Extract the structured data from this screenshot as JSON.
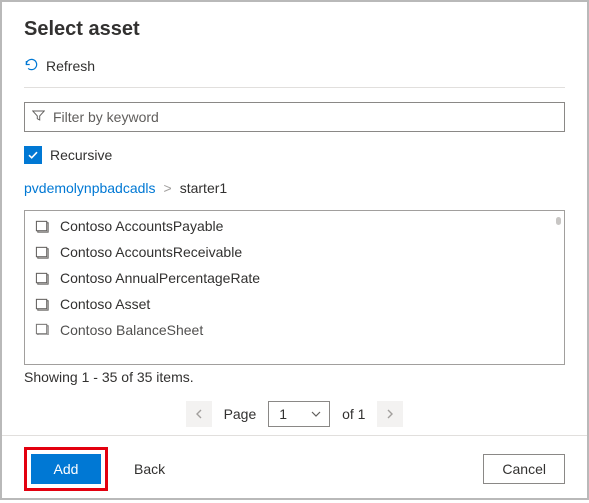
{
  "dialog": {
    "title": "Select asset"
  },
  "toolbar": {
    "refresh_label": "Refresh"
  },
  "filter": {
    "placeholder": "Filter by keyword",
    "value": ""
  },
  "recursive": {
    "label": "Recursive",
    "checked": true
  },
  "breadcrumb": {
    "root": "pvdemolynpbadcadls",
    "sep": ">",
    "current": "starter1"
  },
  "assets": [
    "Contoso AccountsPayable",
    "Contoso AccountsReceivable",
    "Contoso AnnualPercentageRate",
    "Contoso Asset",
    "Contoso BalanceSheet"
  ],
  "status": "Showing 1 - 35 of 35 items.",
  "pager": {
    "page_label": "Page",
    "current": "1",
    "of_text": "of 1"
  },
  "footer": {
    "add_label": "Add",
    "back_label": "Back",
    "cancel_label": "Cancel"
  },
  "colors": {
    "primary": "#0078d4",
    "highlight": "#e3000f"
  }
}
